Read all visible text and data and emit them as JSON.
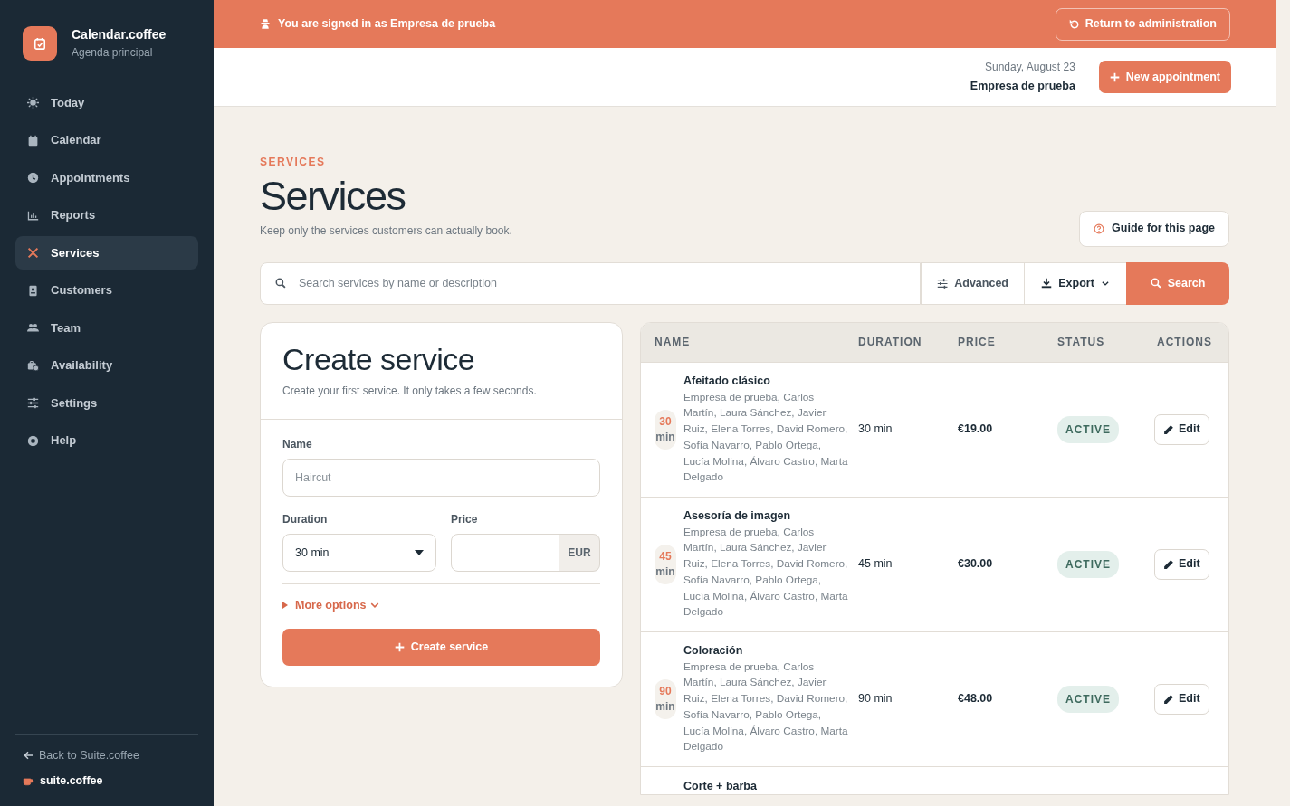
{
  "brand": {
    "name": "Calendar.coffee",
    "subtitle": "Agenda principal"
  },
  "sidebar": {
    "items": [
      {
        "label": "Today",
        "selected": false
      },
      {
        "label": "Calendar",
        "selected": false
      },
      {
        "label": "Appointments",
        "selected": false
      },
      {
        "label": "Reports",
        "selected": false
      },
      {
        "label": "Services",
        "selected": true
      },
      {
        "label": "Customers",
        "selected": false
      },
      {
        "label": "Team",
        "selected": false
      },
      {
        "label": "Availability",
        "selected": false
      },
      {
        "label": "Settings",
        "selected": false
      },
      {
        "label": "Help",
        "selected": false
      }
    ],
    "back_link": "Back to Suite.coffee",
    "footer_brand": "suite.coffee"
  },
  "banner": {
    "text": "You are signed in as Empresa de prueba",
    "button": "Return to administration"
  },
  "header": {
    "date": "Sunday, August 23",
    "company": "Empresa de prueba",
    "button": "New appointment"
  },
  "page": {
    "eyebrow": "SERVICES",
    "title": "Services",
    "subtitle": "Keep only the services customers can actually book.",
    "guide_button": "Guide for this page"
  },
  "search": {
    "placeholder": "Search services by name or description",
    "advanced": "Advanced",
    "export": "Export",
    "button": "Search"
  },
  "create_form": {
    "title": "Create service",
    "subtitle": "Create your first service. It only takes a few seconds.",
    "name_label": "Name",
    "name_placeholder": "Haircut",
    "duration_label": "Duration",
    "duration_value": "30 min",
    "price_label": "Price",
    "currency": "EUR",
    "more_options": "More options",
    "submit": "Create service"
  },
  "table": {
    "columns": [
      "NAME",
      "DURATION",
      "PRICE",
      "STATUS",
      "ACTIONS"
    ],
    "rows": [
      {
        "badge_number": "30",
        "badge_unit": "min",
        "name": "Afeitado clásico",
        "staff": "Empresa de prueba, Carlos Martín, Laura Sánchez, Javier Ruiz, Elena Torres, David Romero, Sofía Navarro, Pablo Ortega, Lucía Molina, Álvaro Castro, Marta Delgado",
        "duration": "30 min",
        "price": "€19.00",
        "status": "ACTIVE",
        "action": "Edit"
      },
      {
        "badge_number": "45",
        "badge_unit": "min",
        "name": "Asesoría de imagen",
        "staff": "Empresa de prueba, Carlos Martín, Laura Sánchez, Javier Ruiz, Elena Torres, David Romero, Sofía Navarro, Pablo Ortega, Lucía Molina, Álvaro Castro, Marta Delgado",
        "duration": "45 min",
        "price": "€30.00",
        "status": "ACTIVE",
        "action": "Edit"
      },
      {
        "badge_number": "90",
        "badge_unit": "min",
        "name": "Coloración",
        "staff": "Empresa de prueba, Carlos Martín, Laura Sánchez, Javier Ruiz, Elena Torres, David Romero, Sofía Navarro, Pablo Ortega, Lucía Molina, Álvaro Castro, Marta Delgado",
        "duration": "90 min",
        "price": "€48.00",
        "status": "ACTIVE",
        "action": "Edit"
      },
      {
        "name": "Corte + barba"
      }
    ]
  }
}
